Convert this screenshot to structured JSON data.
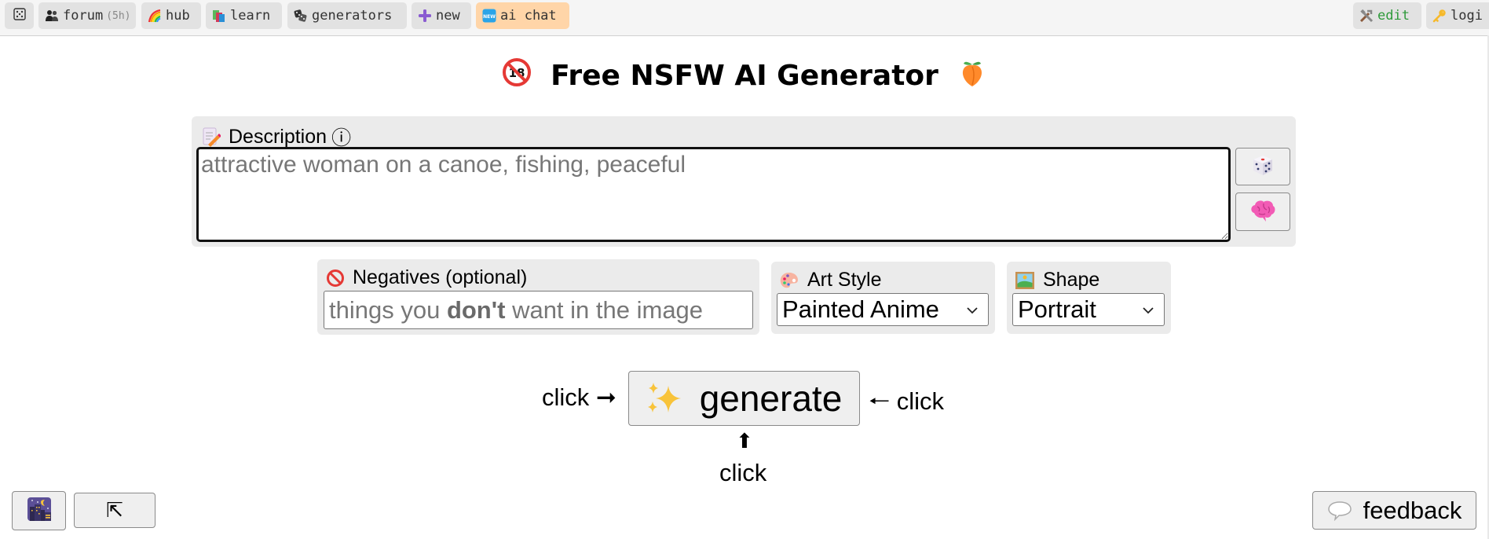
{
  "topbar": {
    "left": [
      {
        "icon": "dice-icon",
        "label": ""
      },
      {
        "icon": "people-icon",
        "label": "forum",
        "sub": "(5h)"
      },
      {
        "icon": "rainbow-icon",
        "label": "hub"
      },
      {
        "icon": "books-icon",
        "label": "learn"
      },
      {
        "icon": "dice-pair-icon",
        "label": "generators"
      },
      {
        "icon": "plus-icon",
        "label": "new"
      },
      {
        "icon": "new-badge-icon",
        "label": "ai chat",
        "badge": "NEW"
      }
    ],
    "right": [
      {
        "icon": "tools-icon",
        "label": "edit"
      },
      {
        "icon": "key-icon",
        "label": "logi"
      }
    ]
  },
  "page": {
    "title": "Free NSFW AI Generator",
    "title_left_icon": "no-under-18-icon",
    "title_right_icon": "peach-icon"
  },
  "description": {
    "label": "Description",
    "info_glyph": "ⓘ",
    "placeholder": "attractive woman on a canoe, fishing, peaceful",
    "value": "",
    "random_button_icon": "dice-icon",
    "ai_button_icon": "brain-icon"
  },
  "negatives": {
    "label": "Negatives (optional)",
    "placeholder_pre": "things you ",
    "placeholder_bold": "don't",
    "placeholder_post": " want in the image"
  },
  "art_style": {
    "label": "Art Style",
    "selected": "Painted Anime"
  },
  "shape": {
    "label": "Shape",
    "selected": "Portrait"
  },
  "generate": {
    "label": "generate",
    "hint_left": "click ➞",
    "hint_right": "🠐 click",
    "hint_up_arrow": "⬆",
    "hint_bottom": "click"
  },
  "bottom": {
    "theme_button_icon": "night-city-icon",
    "popout_button_glyph": "⇱",
    "feedback_label": "feedback"
  },
  "colors": {
    "topbar_bg": "#f5f5f5",
    "tab_bg": "#e2e2e2",
    "ai_chat_bg": "#ffd5a8",
    "edit_text": "#2e9a3a",
    "panel_bg": "#ebebeb"
  }
}
